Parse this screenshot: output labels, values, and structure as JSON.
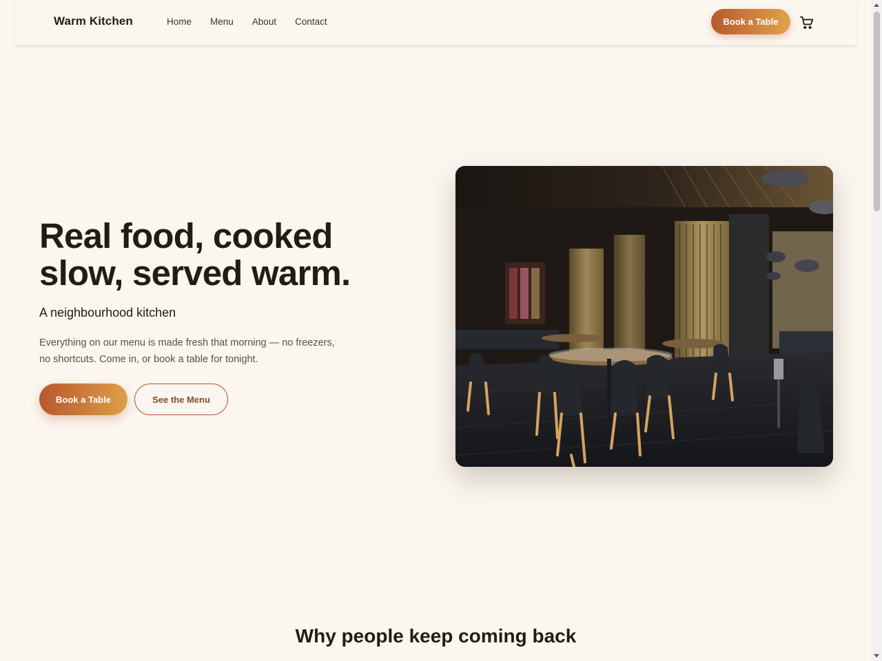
{
  "header": {
    "brand": "Warm Kitchen",
    "nav": [
      "Home",
      "Menu",
      "About",
      "Contact"
    ],
    "cta": "Book a Table"
  },
  "hero": {
    "title_line1": "Real food, cooked",
    "title_line2": "slow, served warm.",
    "subtitle": "A neighbourhood kitchen",
    "body_line1": "Everything on our menu is made fresh that morning — no freezers,",
    "body_line2": "no shortcuts. Come in, or book a table for tonight.",
    "primary_cta": "Book a Table",
    "secondary_cta": "See the Menu",
    "image": "restaurant-dining-room-photo"
  },
  "section": {
    "heading": "Why people keep coming back"
  },
  "icons": {
    "cart": "cart-icon"
  },
  "colors": {
    "accent_start": "#b8582e",
    "accent_end": "#e0a34c",
    "background": "#fbf6f0",
    "text": "#231c16"
  }
}
